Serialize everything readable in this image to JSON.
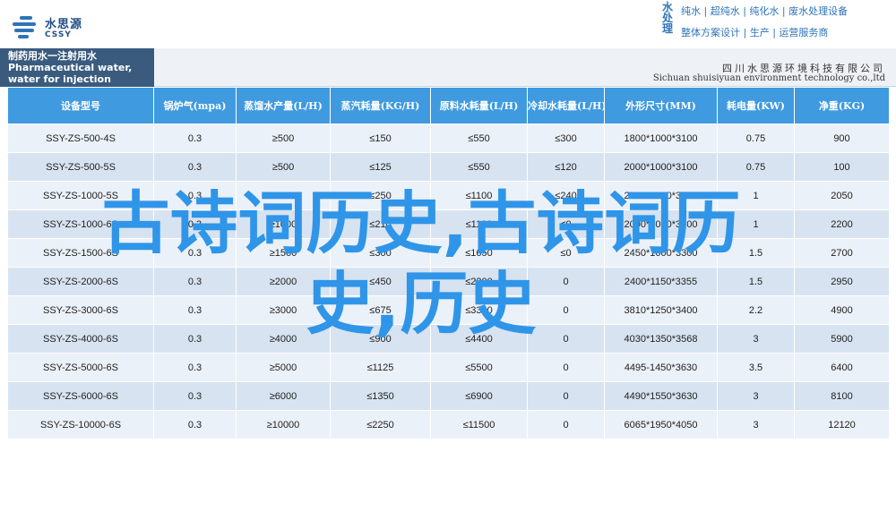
{
  "header": {
    "logo_cn": "水思源",
    "logo_en": "CSSY",
    "brand_vertical": "水处理",
    "brand_line1": "纯水 | 超纯水 | 纯化水 | 废水处理设备",
    "brand_line2": "整体方案设计 | 生产 | 运营服务商"
  },
  "subheader": {
    "product_cn": "制药用水一注射用水",
    "product_en": "Pharmaceutical water, water for injection",
    "company_cn": "四川水思源环境科技有限公司",
    "company_en": "Sichuan shuisiyuan environment technology co.,ltd"
  },
  "table": {
    "headers": [
      "设备型号",
      "锅炉气(mpa)",
      "蒸馏水产量(L/H)",
      "蒸汽耗量(KG/H)",
      "原料水耗量(L/H)",
      "冷却水耗量(L/H)",
      "外形尺寸(MM)",
      "耗电量(KW)",
      "净重(KG)"
    ],
    "rows": [
      [
        "SSY-ZS-500-4S",
        "0.3",
        "≥500",
        "≤150",
        "≤550",
        "≤300",
        "1800*1000*3100",
        "0.75",
        "900"
      ],
      [
        "SSY-ZS-500-5S",
        "0.3",
        "≥500",
        "≤125",
        "≤550",
        "≤120",
        "2000*1000*3100",
        "0.75",
        "100"
      ],
      [
        "SSY-ZS-1000-5S",
        "0.3",
        "≥1000",
        "≤250",
        "≤1100",
        "≤240",
        "2000*1000*3100",
        "1",
        "2050"
      ],
      [
        "SSY-ZS-1000-6S",
        "0.3",
        "≥1000",
        "≤210",
        "≤1100",
        "≤0",
        "2000*1000*3100",
        "1",
        "2200"
      ],
      [
        "SSY-ZS-1500-6S",
        "0.3",
        "≥1500",
        "≤300",
        "≤1650",
        "≤0",
        "2450*1000*3300",
        "1.5",
        "2700"
      ],
      [
        "SSY-ZS-2000-6S",
        "0.3",
        "≥2000",
        "≤450",
        "≤2200",
        "0",
        "2400*1150*3355",
        "1.5",
        "2950"
      ],
      [
        "SSY-ZS-3000-6S",
        "0.3",
        "≥3000",
        "≤675",
        "≤3300",
        "0",
        "3810*1250*3400",
        "2.2",
        "4900"
      ],
      [
        "SSY-ZS-4000-6S",
        "0.3",
        "≥4000",
        "≤900",
        "≤4400",
        "0",
        "4030*1350*3568",
        "3",
        "5900"
      ],
      [
        "SSY-ZS-5000-6S",
        "0.3",
        "≥5000",
        "≤1125",
        "≤5500",
        "0",
        "4495-1450*3630",
        "3.5",
        "6400"
      ],
      [
        "SSY-ZS-6000-6S",
        "0.3",
        "≥6000",
        "≤1350",
        "≤6900",
        "0",
        "4490*1550*3630",
        "3",
        "8100"
      ],
      [
        "SSY-ZS-10000-6S",
        "0.3",
        "≥10000",
        "≤2250",
        "≤11500",
        "0",
        "6065*1950*4050",
        "3",
        "12120"
      ]
    ]
  },
  "overlay": {
    "line1": "古诗词历史,古诗词历",
    "line2": "史,历史"
  }
}
